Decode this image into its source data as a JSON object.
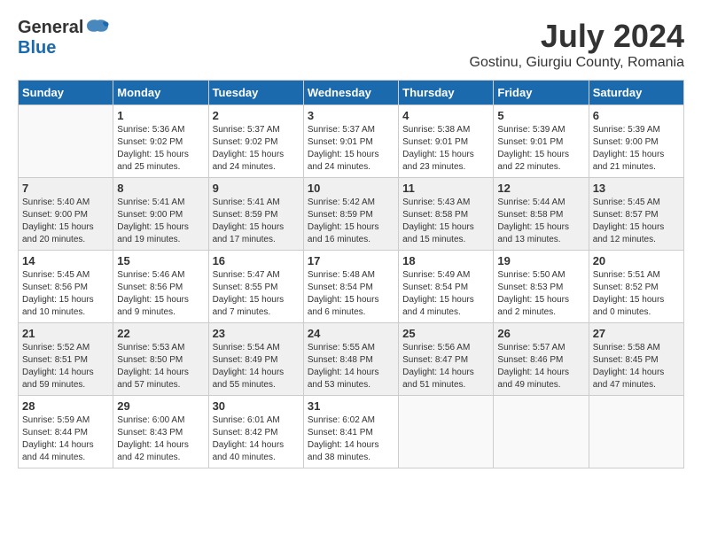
{
  "header": {
    "logo_general": "General",
    "logo_blue": "Blue",
    "month": "July 2024",
    "location": "Gostinu, Giurgiu County, Romania"
  },
  "weekdays": [
    "Sunday",
    "Monday",
    "Tuesday",
    "Wednesday",
    "Thursday",
    "Friday",
    "Saturday"
  ],
  "weeks": [
    [
      {
        "day": "",
        "info": ""
      },
      {
        "day": "1",
        "info": "Sunrise: 5:36 AM\nSunset: 9:02 PM\nDaylight: 15 hours\nand 25 minutes."
      },
      {
        "day": "2",
        "info": "Sunrise: 5:37 AM\nSunset: 9:02 PM\nDaylight: 15 hours\nand 24 minutes."
      },
      {
        "day": "3",
        "info": "Sunrise: 5:37 AM\nSunset: 9:01 PM\nDaylight: 15 hours\nand 24 minutes."
      },
      {
        "day": "4",
        "info": "Sunrise: 5:38 AM\nSunset: 9:01 PM\nDaylight: 15 hours\nand 23 minutes."
      },
      {
        "day": "5",
        "info": "Sunrise: 5:39 AM\nSunset: 9:01 PM\nDaylight: 15 hours\nand 22 minutes."
      },
      {
        "day": "6",
        "info": "Sunrise: 5:39 AM\nSunset: 9:00 PM\nDaylight: 15 hours\nand 21 minutes."
      }
    ],
    [
      {
        "day": "7",
        "info": "Sunrise: 5:40 AM\nSunset: 9:00 PM\nDaylight: 15 hours\nand 20 minutes."
      },
      {
        "day": "8",
        "info": "Sunrise: 5:41 AM\nSunset: 9:00 PM\nDaylight: 15 hours\nand 19 minutes."
      },
      {
        "day": "9",
        "info": "Sunrise: 5:41 AM\nSunset: 8:59 PM\nDaylight: 15 hours\nand 17 minutes."
      },
      {
        "day": "10",
        "info": "Sunrise: 5:42 AM\nSunset: 8:59 PM\nDaylight: 15 hours\nand 16 minutes."
      },
      {
        "day": "11",
        "info": "Sunrise: 5:43 AM\nSunset: 8:58 PM\nDaylight: 15 hours\nand 15 minutes."
      },
      {
        "day": "12",
        "info": "Sunrise: 5:44 AM\nSunset: 8:58 PM\nDaylight: 15 hours\nand 13 minutes."
      },
      {
        "day": "13",
        "info": "Sunrise: 5:45 AM\nSunset: 8:57 PM\nDaylight: 15 hours\nand 12 minutes."
      }
    ],
    [
      {
        "day": "14",
        "info": "Sunrise: 5:45 AM\nSunset: 8:56 PM\nDaylight: 15 hours\nand 10 minutes."
      },
      {
        "day": "15",
        "info": "Sunrise: 5:46 AM\nSunset: 8:56 PM\nDaylight: 15 hours\nand 9 minutes."
      },
      {
        "day": "16",
        "info": "Sunrise: 5:47 AM\nSunset: 8:55 PM\nDaylight: 15 hours\nand 7 minutes."
      },
      {
        "day": "17",
        "info": "Sunrise: 5:48 AM\nSunset: 8:54 PM\nDaylight: 15 hours\nand 6 minutes."
      },
      {
        "day": "18",
        "info": "Sunrise: 5:49 AM\nSunset: 8:54 PM\nDaylight: 15 hours\nand 4 minutes."
      },
      {
        "day": "19",
        "info": "Sunrise: 5:50 AM\nSunset: 8:53 PM\nDaylight: 15 hours\nand 2 minutes."
      },
      {
        "day": "20",
        "info": "Sunrise: 5:51 AM\nSunset: 8:52 PM\nDaylight: 15 hours\nand 0 minutes."
      }
    ],
    [
      {
        "day": "21",
        "info": "Sunrise: 5:52 AM\nSunset: 8:51 PM\nDaylight: 14 hours\nand 59 minutes."
      },
      {
        "day": "22",
        "info": "Sunrise: 5:53 AM\nSunset: 8:50 PM\nDaylight: 14 hours\nand 57 minutes."
      },
      {
        "day": "23",
        "info": "Sunrise: 5:54 AM\nSunset: 8:49 PM\nDaylight: 14 hours\nand 55 minutes."
      },
      {
        "day": "24",
        "info": "Sunrise: 5:55 AM\nSunset: 8:48 PM\nDaylight: 14 hours\nand 53 minutes."
      },
      {
        "day": "25",
        "info": "Sunrise: 5:56 AM\nSunset: 8:47 PM\nDaylight: 14 hours\nand 51 minutes."
      },
      {
        "day": "26",
        "info": "Sunrise: 5:57 AM\nSunset: 8:46 PM\nDaylight: 14 hours\nand 49 minutes."
      },
      {
        "day": "27",
        "info": "Sunrise: 5:58 AM\nSunset: 8:45 PM\nDaylight: 14 hours\nand 47 minutes."
      }
    ],
    [
      {
        "day": "28",
        "info": "Sunrise: 5:59 AM\nSunset: 8:44 PM\nDaylight: 14 hours\nand 44 minutes."
      },
      {
        "day": "29",
        "info": "Sunrise: 6:00 AM\nSunset: 8:43 PM\nDaylight: 14 hours\nand 42 minutes."
      },
      {
        "day": "30",
        "info": "Sunrise: 6:01 AM\nSunset: 8:42 PM\nDaylight: 14 hours\nand 40 minutes."
      },
      {
        "day": "31",
        "info": "Sunrise: 6:02 AM\nSunset: 8:41 PM\nDaylight: 14 hours\nand 38 minutes."
      },
      {
        "day": "",
        "info": ""
      },
      {
        "day": "",
        "info": ""
      },
      {
        "day": "",
        "info": ""
      }
    ]
  ],
  "shaded_rows": [
    1,
    3
  ]
}
